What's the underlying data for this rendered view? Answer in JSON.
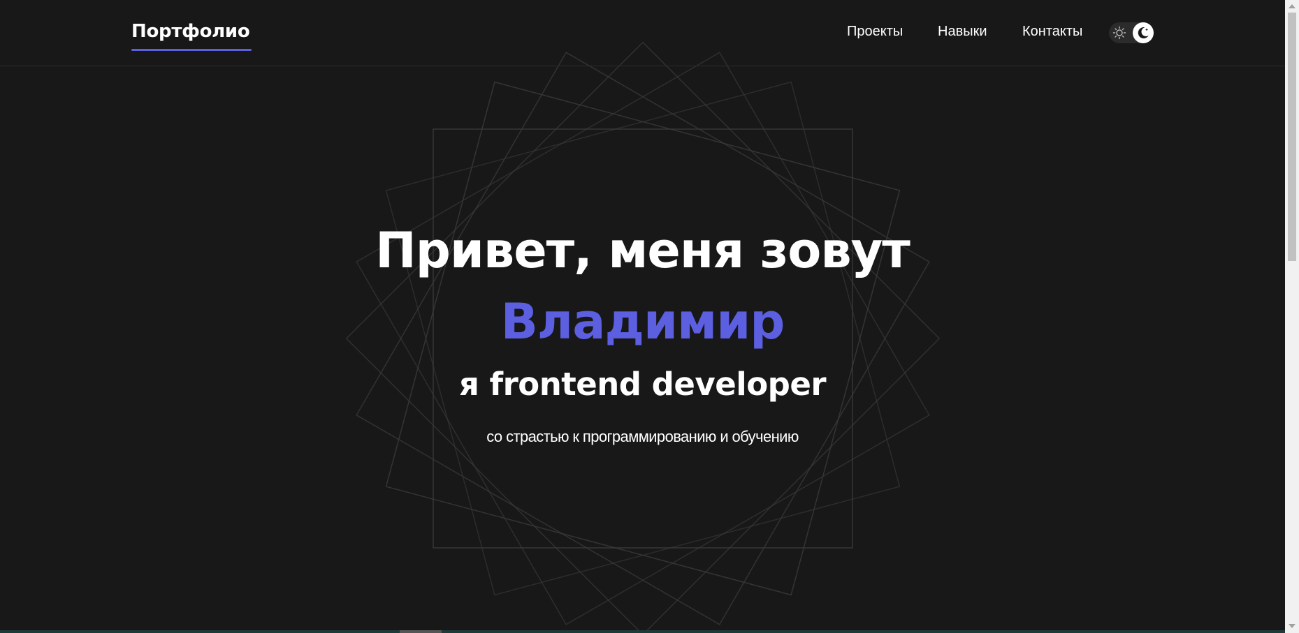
{
  "header": {
    "logo": "Портфолио",
    "nav": [
      {
        "label": "Проекты"
      },
      {
        "label": "Навыки"
      },
      {
        "label": "Контакты"
      }
    ],
    "theme_toggle": {
      "mode": "dark",
      "icons": [
        "sun-icon",
        "moon-icon"
      ]
    }
  },
  "hero": {
    "title": "Привет, меня зовут",
    "name": "Владимир",
    "role": "я frontend developer",
    "tagline": "со страстью к программированию и обучению"
  },
  "colors": {
    "background": "#181818",
    "accent": "#5b5fe0",
    "text": "#ffffff",
    "decor_lines": "#3a3a3a"
  }
}
